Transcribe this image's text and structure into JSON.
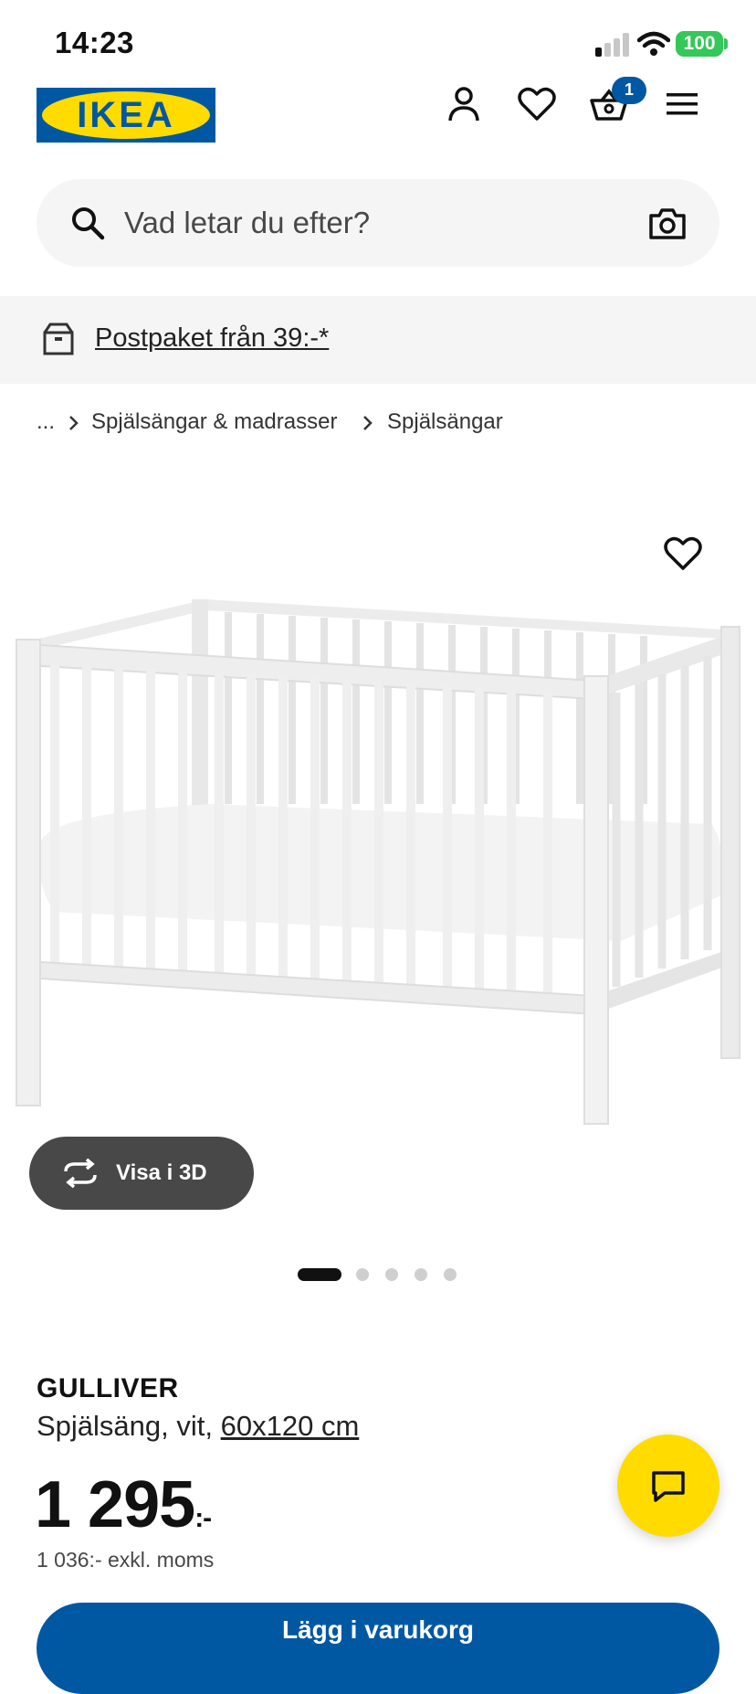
{
  "status_bar": {
    "time": "14:23",
    "battery": "100"
  },
  "header": {
    "logo_text": "IKEA",
    "cart_count": "1"
  },
  "search": {
    "placeholder": "Vad letar du efter?"
  },
  "promo": {
    "text": "Postpaket från 39:-*"
  },
  "breadcrumb": {
    "items": [
      "...",
      "Spjälsängar & madrasser",
      "Spjälsängar"
    ]
  },
  "gallery": {
    "view_3d_label": "Visa i 3D",
    "image_count": 5,
    "active_index": 0
  },
  "product": {
    "name": "GULLIVER",
    "description": "Spjälsäng, vit,",
    "size": "60x120 cm",
    "price": "1 295",
    "price_suffix": ":-",
    "price_excl_vat": "1 036:- exkl. moms"
  },
  "cta": {
    "label": "Lägg i varukorg"
  },
  "colors": {
    "brand_blue": "#0058a3",
    "brand_yellow": "#ffdb00",
    "battery_green": "#34c759"
  },
  "icons": [
    "account-icon",
    "heart-icon",
    "cart-icon",
    "menu-icon",
    "search-icon",
    "camera-icon",
    "package-icon",
    "rotate-3d-icon",
    "chat-icon"
  ]
}
